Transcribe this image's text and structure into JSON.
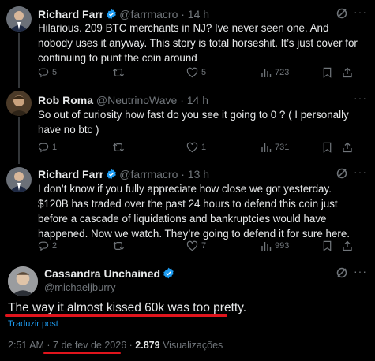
{
  "tweets": [
    {
      "name": "Richard Farr",
      "handle": "@farrmacro",
      "time": "· 14 h",
      "text": "Hilarious.  209 BTC merchants in NJ?  Ive never seen one.  And nobody uses it anyway.  This story is total horseshit.  It’s just cover for continuing to punt the coin around",
      "replies": "5",
      "reposts": "",
      "likes": "5",
      "views": "723"
    },
    {
      "name": "Rob Roma",
      "handle": "@NeutrinoWave",
      "time": "· 14 h",
      "text": "So out of curiosity how fast do you see it going to 0 ?  ( I personally have no btc )",
      "replies": "1",
      "reposts": "",
      "likes": "1",
      "views": "731"
    },
    {
      "name": "Richard Farr",
      "handle": "@farrmacro",
      "time": "· 13 h",
      "text": "I don’t know if you fully appreciate how close we got yesterday.  $120B has traded over the past 24 hours to defend this coin just before a cascade of liquidations and bankruptcies would have happened.  Now we watch.  They’re going to defend it for sure here.",
      "replies": "2",
      "reposts": "",
      "likes": "7",
      "views": "993"
    }
  ],
  "main_tweet": {
    "name": "Cassandra Unchained",
    "handle": "@michaeljburry",
    "text": "The way it almost kissed 60k was too pretty.",
    "translate": "Traduzir post",
    "time": "2:51 AM",
    "date": "7 de fev de 2026",
    "separator": "·",
    "views_count": "2.879",
    "views_label": "Visualizações"
  },
  "icons": {
    "verified": "verified-badge-icon",
    "grok": "grok-icon",
    "more": "more-options-icon",
    "reply": "reply-icon",
    "repost": "repost-icon",
    "like": "like-icon",
    "views": "views-icon",
    "bookmark": "bookmark-icon",
    "share": "share-icon"
  },
  "colors": {
    "background": "#000000",
    "text": "#e7e9ea",
    "muted": "#71767b",
    "accent": "#1d9bf0",
    "annotation": "#e0141c"
  }
}
